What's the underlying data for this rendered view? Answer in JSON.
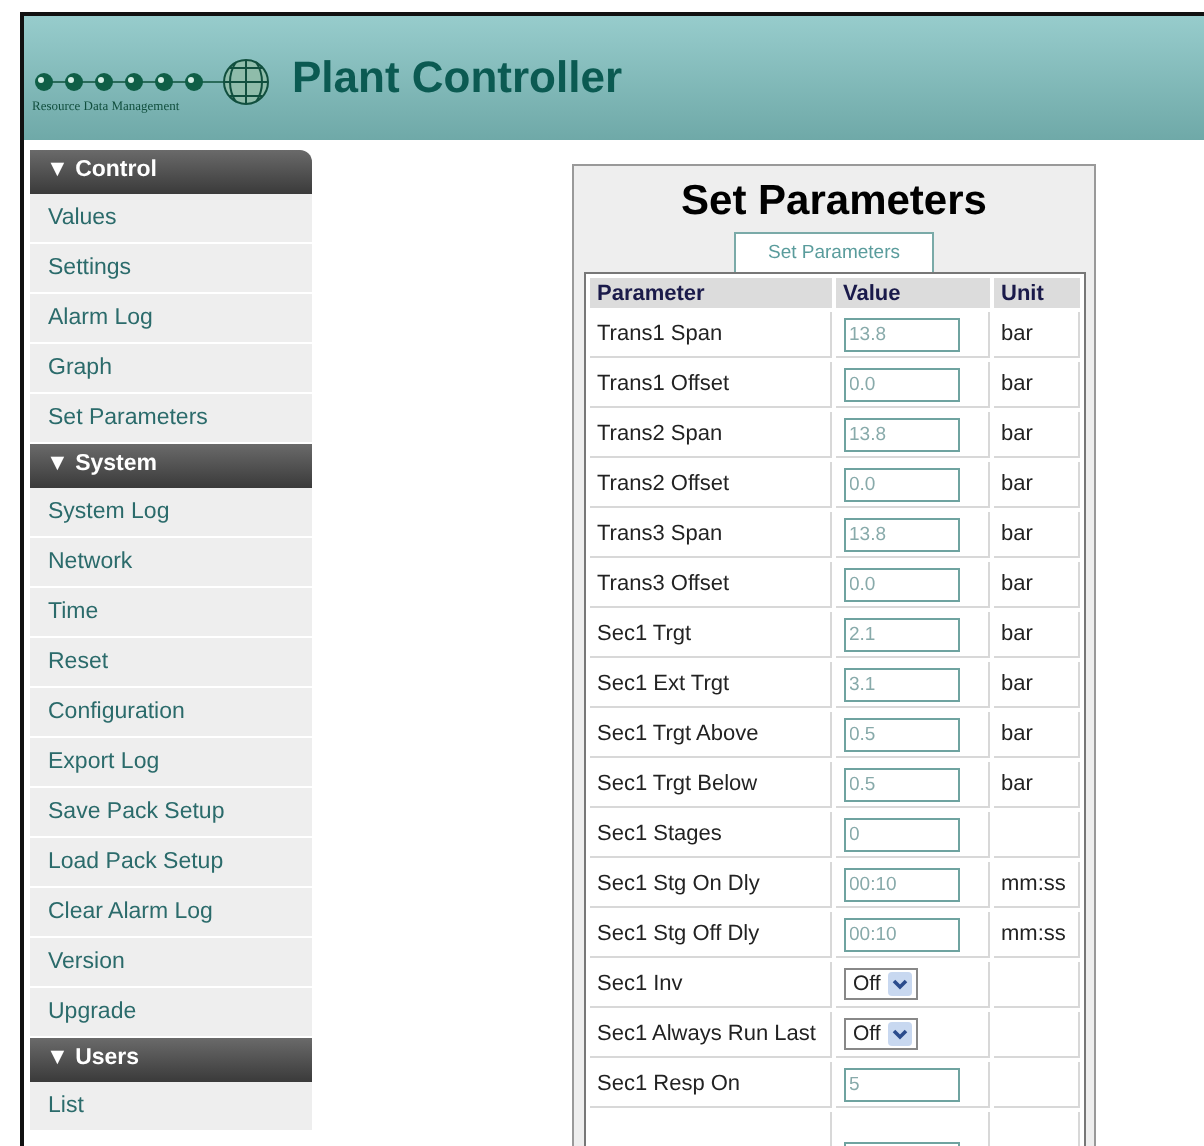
{
  "header": {
    "logo_text": "Resource Data Management",
    "title": "Plant Controller"
  },
  "sidebar": {
    "sections": [
      {
        "title": "Control",
        "marker": "▼",
        "items": [
          "Values",
          "Settings",
          "Alarm Log",
          "Graph",
          "Set Parameters"
        ]
      },
      {
        "title": "System",
        "marker": "▼",
        "items": [
          "System Log",
          "Network",
          "Time",
          "Reset",
          "Configuration",
          "Export Log",
          "Save Pack Setup",
          "Load Pack Setup",
          "Clear Alarm Log",
          "Version",
          "Upgrade"
        ]
      },
      {
        "title": "Users",
        "marker": "▼",
        "items": [
          "List"
        ]
      }
    ]
  },
  "panel": {
    "title": "Set Parameters",
    "button": "Set Parameters",
    "columns": [
      "Parameter",
      "Value",
      "Unit"
    ],
    "rows": [
      {
        "kind": "text",
        "parameter": "Trans1 Span",
        "value": "13.8",
        "unit": "bar"
      },
      {
        "kind": "text",
        "parameter": "Trans1 Offset",
        "value": "0.0",
        "unit": "bar"
      },
      {
        "kind": "text",
        "parameter": "Trans2 Span",
        "value": "13.8",
        "unit": "bar"
      },
      {
        "kind": "text",
        "parameter": "Trans2 Offset",
        "value": "0.0",
        "unit": "bar"
      },
      {
        "kind": "text",
        "parameter": "Trans3 Span",
        "value": "13.8",
        "unit": "bar"
      },
      {
        "kind": "text",
        "parameter": "Trans3 Offset",
        "value": "0.0",
        "unit": "bar"
      },
      {
        "kind": "text",
        "parameter": "Sec1 Trgt",
        "value": "2.1",
        "unit": "bar"
      },
      {
        "kind": "text",
        "parameter": "Sec1 Ext Trgt",
        "value": "3.1",
        "unit": "bar"
      },
      {
        "kind": "text",
        "parameter": "Sec1 Trgt Above",
        "value": "0.5",
        "unit": "bar"
      },
      {
        "kind": "text",
        "parameter": "Sec1 Trgt Below",
        "value": "0.5",
        "unit": "bar"
      },
      {
        "kind": "text",
        "parameter": "Sec1 Stages",
        "value": "0"
      },
      {
        "kind": "text",
        "parameter": "Sec1 Stg On Dly",
        "value": "00:10",
        "unit": "mm:ss"
      },
      {
        "kind": "text",
        "parameter": "Sec1 Stg Off Dly",
        "value": "00:10",
        "unit": "mm:ss"
      },
      {
        "kind": "select",
        "parameter": "Sec1 Inv",
        "value": "Off"
      },
      {
        "kind": "select",
        "parameter": "Sec1 Always Run Last",
        "value": "Off"
      },
      {
        "kind": "text",
        "parameter": "Sec1 Resp On",
        "value": "5"
      }
    ]
  }
}
